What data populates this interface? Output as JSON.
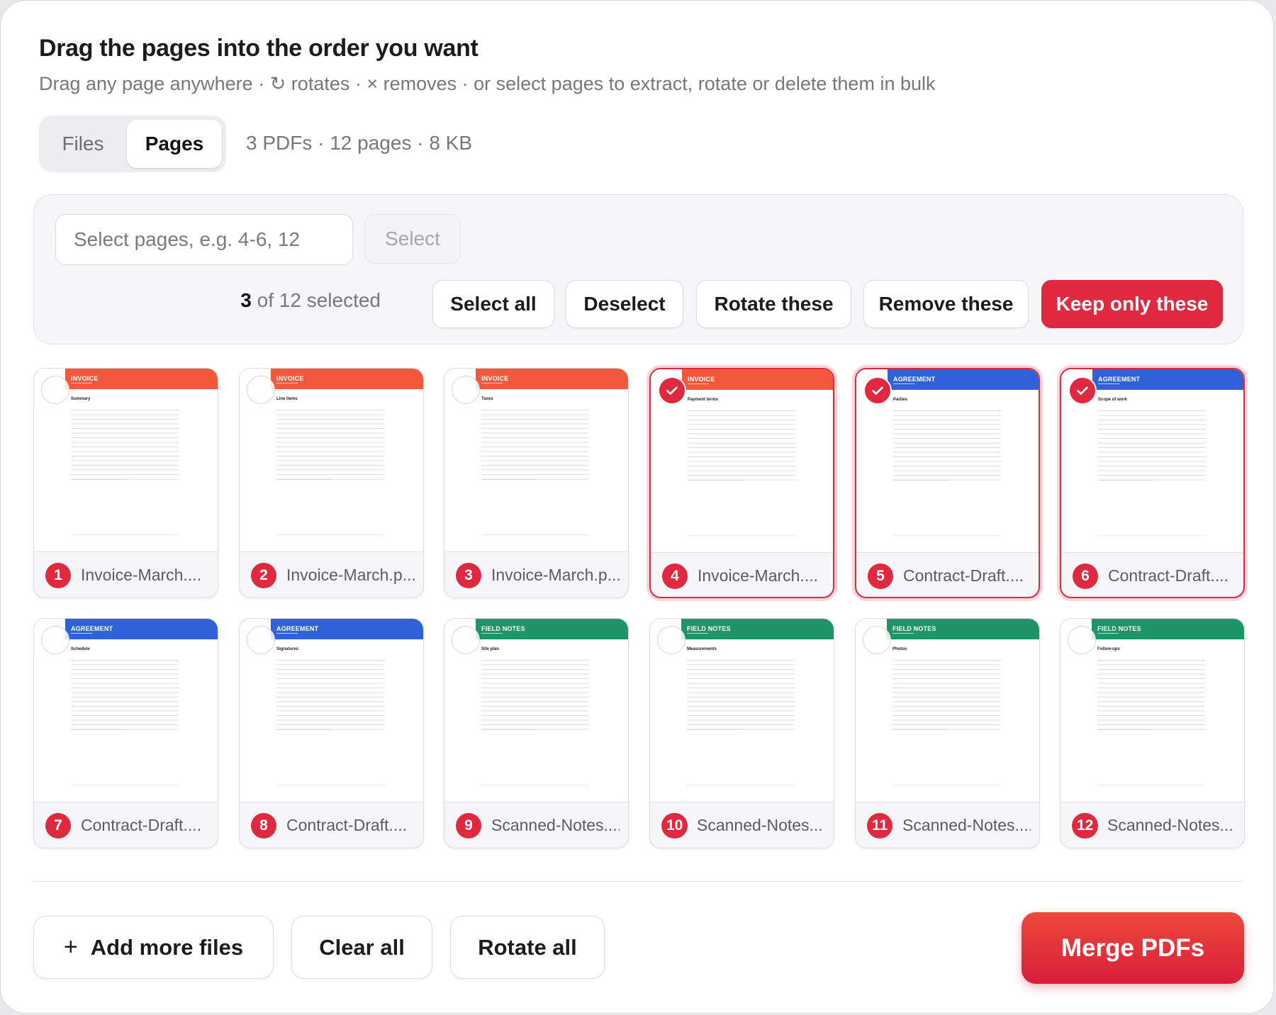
{
  "header": {
    "title": "Drag the pages into the order you want",
    "subtitle": "Drag any page anywhere · ↻ rotates · × removes · or select pages to extract, rotate or delete them in bulk"
  },
  "view_toggle": {
    "files_label": "Files",
    "pages_label": "Pages",
    "active": "Pages"
  },
  "summary": "3 PDFs · 12 pages · 8 KB",
  "selection": {
    "input_placeholder": "Select pages, e.g. 4-6, 12",
    "input_value": "",
    "select_label": "Select",
    "count": "3",
    "count_suffix": " of 12 selected",
    "select_all_label": "Select all",
    "deselect_label": "Deselect",
    "rotate_label": "Rotate these",
    "remove_label": "Remove these",
    "keep_label": "Keep only these"
  },
  "colors": {
    "accent": "#e0283f",
    "invoice": "#f4583a",
    "agreement": "#2f62d8",
    "field_notes": "#1f9467"
  },
  "pages": [
    {
      "num": "1",
      "file": "Invoice-March....",
      "doc": "INVOICE",
      "section": "Summary",
      "selected": false
    },
    {
      "num": "2",
      "file": "Invoice-March.p...",
      "doc": "INVOICE",
      "section": "Line items",
      "selected": false
    },
    {
      "num": "3",
      "file": "Invoice-March.p...",
      "doc": "INVOICE",
      "section": "Taxes",
      "selected": false
    },
    {
      "num": "4",
      "file": "Invoice-March....",
      "doc": "INVOICE",
      "section": "Payment terms",
      "selected": true
    },
    {
      "num": "5",
      "file": "Contract-Draft....",
      "doc": "AGREEMENT",
      "section": "Parties",
      "selected": true
    },
    {
      "num": "6",
      "file": "Contract-Draft....",
      "doc": "AGREEMENT",
      "section": "Scope of work",
      "selected": true
    },
    {
      "num": "7",
      "file": "Contract-Draft....",
      "doc": "AGREEMENT",
      "section": "Schedule",
      "selected": false
    },
    {
      "num": "8",
      "file": "Contract-Draft....",
      "doc": "AGREEMENT",
      "section": "Signatures",
      "selected": false
    },
    {
      "num": "9",
      "file": "Scanned-Notes....",
      "doc": "FIELD NOTES",
      "section": "Site plan",
      "selected": false
    },
    {
      "num": "10",
      "file": "Scanned-Notes...",
      "doc": "FIELD NOTES",
      "section": "Measurements",
      "selected": false
    },
    {
      "num": "11",
      "file": "Scanned-Notes....",
      "doc": "FIELD NOTES",
      "section": "Photos",
      "selected": false
    },
    {
      "num": "12",
      "file": "Scanned-Notes...",
      "doc": "FIELD NOTES",
      "section": "Follow-ups",
      "selected": false
    }
  ],
  "footer": {
    "add_label": "Add more files",
    "clear_label": "Clear all",
    "rotate_all_label": "Rotate all",
    "merge_label": "Merge PDFs"
  }
}
